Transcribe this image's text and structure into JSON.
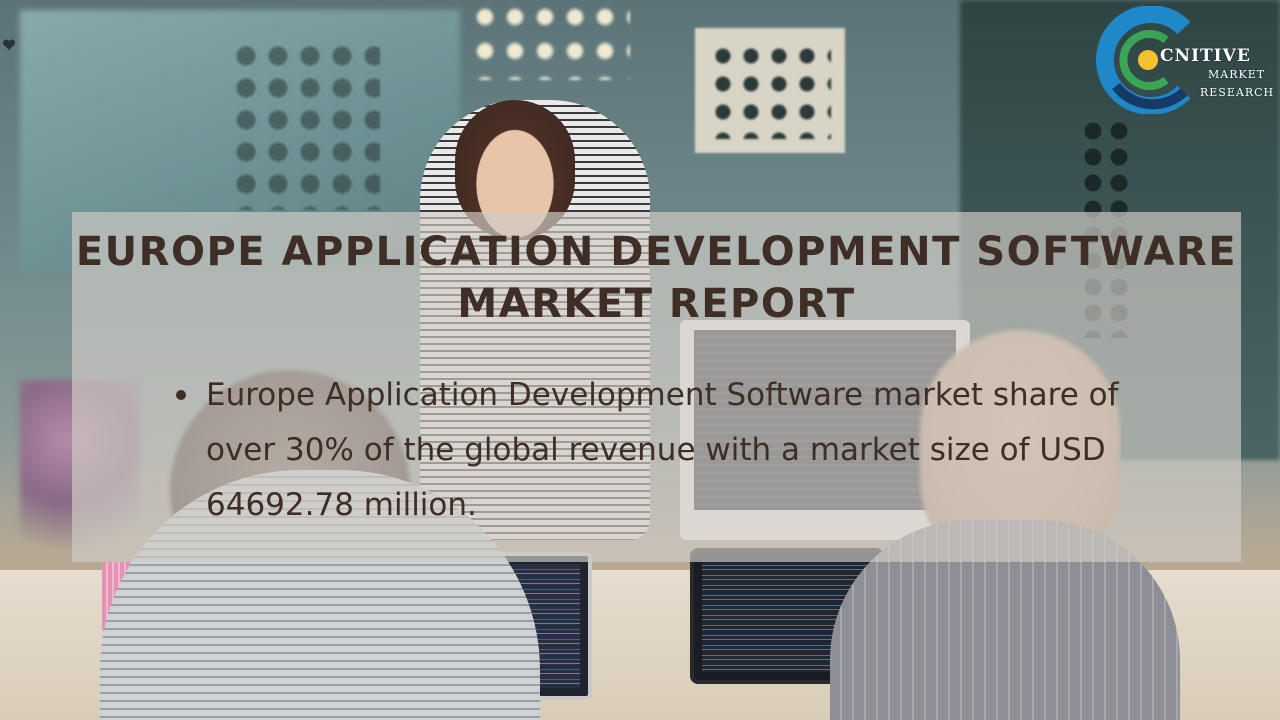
{
  "slide": {
    "title": "EUROPE APPLICATION DEVELOPMENT SOFTWARE MARKET REPORT",
    "bullets": [
      "Europe Application Development Software market share of over 30% of the global revenue with a market size of USD 64692.78 million."
    ]
  },
  "logo": {
    "main_text": "CNITIVE",
    "sub_line_1": "MARKET",
    "sub_line_2": "RESEARCH",
    "colors": {
      "ring_blue": "#1e88c8",
      "ring_green": "#3aa655",
      "ring_yellow": "#f2c230",
      "ring_navy": "#163a66"
    }
  },
  "theme": {
    "overlay_color": "#d0ccc6",
    "text_color": "#3f2e26"
  },
  "icons": {
    "heart": "heart-icon"
  }
}
